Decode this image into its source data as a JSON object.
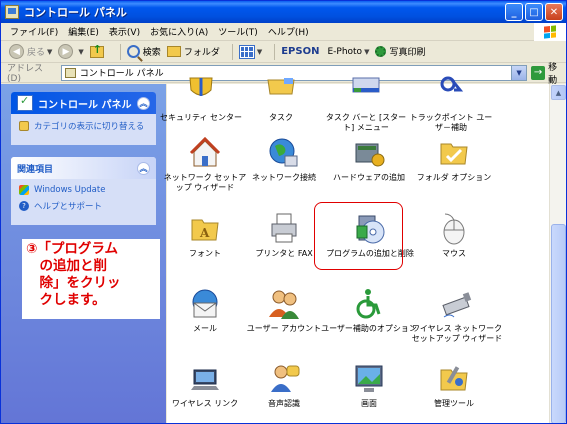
{
  "window": {
    "title": "コントロール パネル"
  },
  "menu": [
    "ファイル(F)",
    "編集(E)",
    "表示(V)",
    "お気に入り(A)",
    "ツール(T)",
    "ヘルプ(H)"
  ],
  "toolbar": {
    "back": "戻る",
    "search": "検索",
    "folders": "フォルダ",
    "epson": "EPSON",
    "ephoto": "E-Photo",
    "photo_print": "写真印刷"
  },
  "address": {
    "label": "アドレス(D)",
    "value": "コントロール パネル",
    "go": "移動"
  },
  "taskpane": {
    "main_title": "コントロール パネル",
    "switch_view": "カテゴリの表示に切り替える",
    "related_title": "関連項目",
    "related": [
      "Windows Update",
      "ヘルプとサポート"
    ]
  },
  "instruction": [
    "③「プログラム",
    "　の追加と削",
    "　除」をクリッ",
    "　クします。"
  ],
  "items": [
    {
      "label": "セキュリティ センター",
      "icon": "shield-icon"
    },
    {
      "label": "タスク",
      "icon": "folder-icon"
    },
    {
      "label": "タスク バーと [スタート] メニュー",
      "icon": "taskbar-icon"
    },
    {
      "label": "トラックポイント ユーザ－補助",
      "icon": "accessibility-icon"
    },
    {
      "label": "ネットワーク セットアップ ウィザード",
      "icon": "home-network-icon"
    },
    {
      "label": "ネットワーク接続",
      "icon": "globe-icon"
    },
    {
      "label": "ハードウェアの追加",
      "icon": "hardware-icon"
    },
    {
      "label": "フォルダ オプション",
      "icon": "folder-options-icon"
    },
    {
      "label": "フォント",
      "icon": "fonts-folder-icon"
    },
    {
      "label": "プリンタと FAX",
      "icon": "printer-icon"
    },
    {
      "label": "プログラムの追加と削除",
      "icon": "add-remove-programs-icon"
    },
    {
      "label": "マウス",
      "icon": "mouse-icon"
    },
    {
      "label": "メール",
      "icon": "mail-icon"
    },
    {
      "label": "ユーザー アカウント",
      "icon": "users-icon"
    },
    {
      "label": "ユーザー補助のオプション",
      "icon": "accessibility-options-icon"
    },
    {
      "label": "ワイヤレス ネットワーク セットアップ ウィザード",
      "icon": "usb-wireless-icon"
    },
    {
      "label": "ワイヤレス リンク",
      "icon": "wireless-link-icon"
    },
    {
      "label": "音声認識",
      "icon": "speech-icon"
    },
    {
      "label": "画面",
      "icon": "display-icon"
    },
    {
      "label": "管理ツール",
      "icon": "admin-tools-icon"
    }
  ],
  "colors": {
    "highlight": "#e00000",
    "instruction_text": "#e00000",
    "pane_blue": "#6375d6"
  }
}
